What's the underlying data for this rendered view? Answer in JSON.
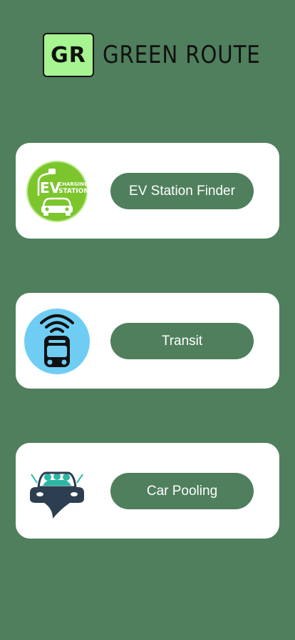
{
  "app": {
    "logo_badge": "GR",
    "title": "GREEN ROUTE"
  },
  "cards": [
    {
      "icon": "ev-charging-station-icon",
      "label": "EV Station Finder",
      "icon_text_big": "EV",
      "icon_text_small_1": "CHARGING",
      "icon_text_small_2": "STATION"
    },
    {
      "icon": "transit-train-wifi-icon",
      "label": "Transit"
    },
    {
      "icon": "car-pooling-icon",
      "label": "Car Pooling"
    }
  ],
  "colors": {
    "background": "#4f7f5c",
    "button": "#4f7f5c",
    "logo_badge": "#a6f590",
    "ev_green": "#7cc52d",
    "transit_blue": "#6fcdf4",
    "carpool_teal": "#2bb8a3",
    "carpool_dark": "#2c3e50"
  }
}
